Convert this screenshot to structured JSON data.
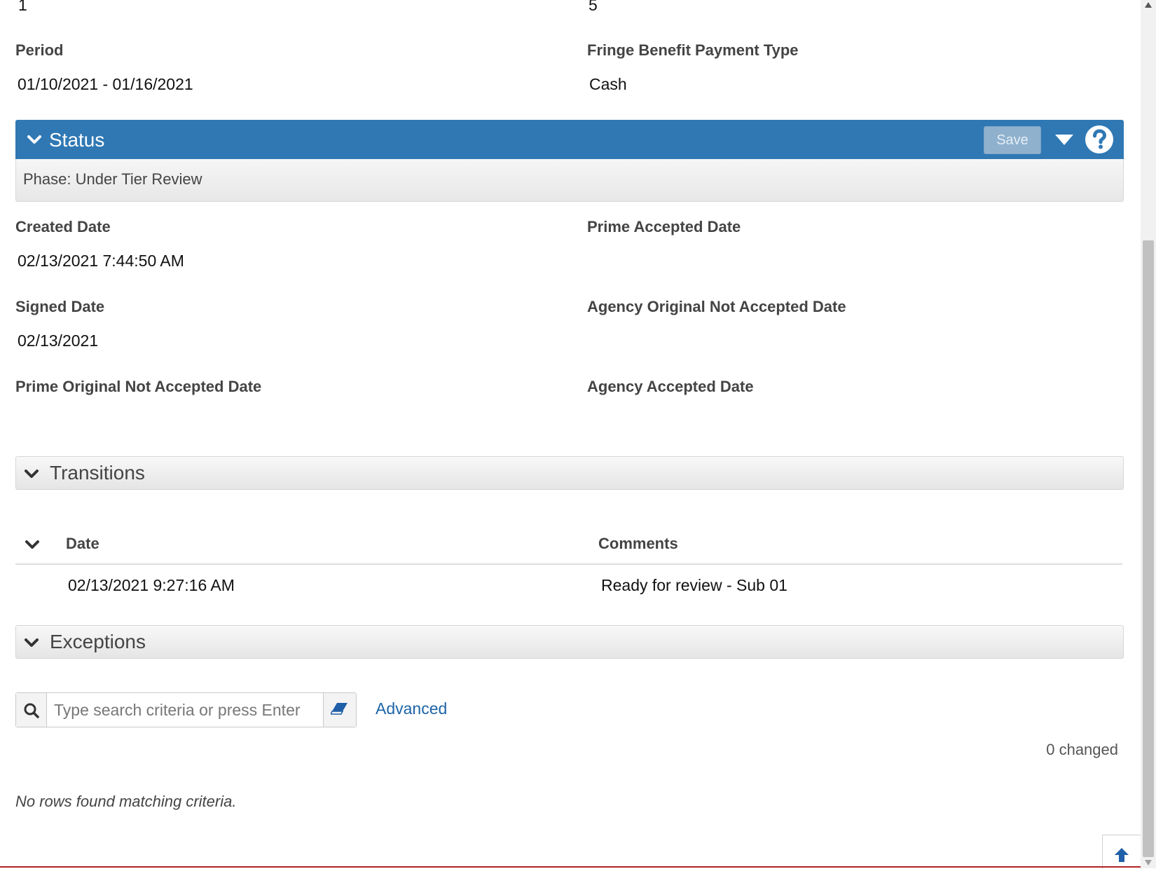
{
  "top_values": {
    "left": "1",
    "right": "5"
  },
  "period": {
    "label": "Period",
    "value": "01/10/2021 - 01/16/2021"
  },
  "fringe": {
    "label": "Fringe Benefit Payment Type",
    "value": "Cash"
  },
  "status": {
    "title": "Status",
    "save_label": "Save",
    "phase": "Phase: Under Tier Review",
    "colors": {
      "header": "#2f78b4"
    }
  },
  "fields": {
    "created_date": {
      "label": "Created Date",
      "value": "02/13/2021 7:44:50 AM"
    },
    "prime_accepted_date": {
      "label": "Prime Accepted Date",
      "value": ""
    },
    "signed_date": {
      "label": "Signed Date",
      "value": "02/13/2021"
    },
    "agency_original_not_accepted_date": {
      "label": "Agency Original Not Accepted Date",
      "value": ""
    },
    "prime_original_not_accepted_date": {
      "label": "Prime Original Not Accepted Date",
      "value": ""
    },
    "agency_accepted_date": {
      "label": "Agency Accepted Date",
      "value": ""
    }
  },
  "transitions": {
    "title": "Transitions",
    "columns": {
      "date": "Date",
      "comments": "Comments"
    },
    "rows": [
      {
        "date": "02/13/2021 9:27:16 AM",
        "comments": "Ready for review - Sub 01"
      }
    ]
  },
  "exceptions": {
    "title": "Exceptions",
    "search_placeholder": "Type search criteria or press Enter",
    "advanced_label": "Advanced",
    "changed_text": "0 changed",
    "empty_text": "No rows found matching criteria."
  },
  "icons": [
    "chevron-down-icon",
    "dropdown-arrow-icon",
    "help-icon",
    "search-icon",
    "eraser-icon",
    "arrow-up-icon"
  ]
}
